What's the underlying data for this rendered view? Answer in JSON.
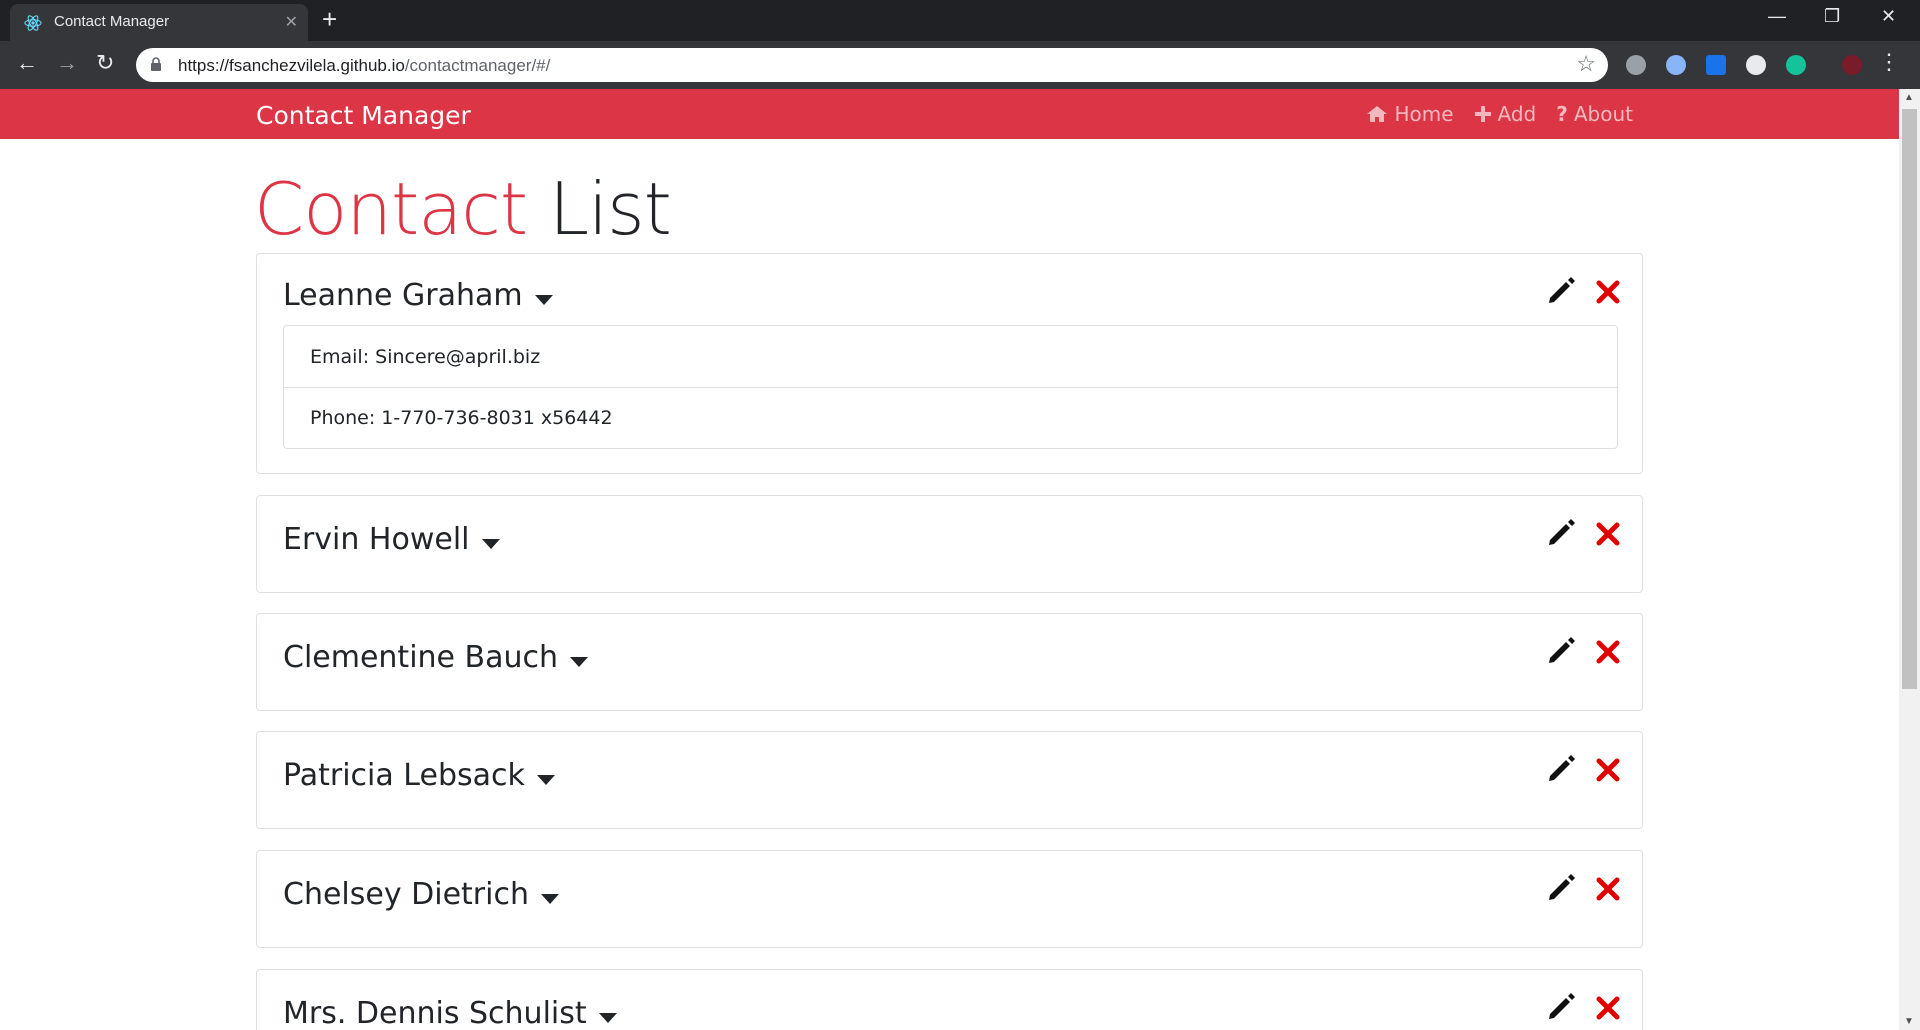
{
  "browser": {
    "tab_title": "Contact Manager",
    "url_host": "https://fsanchezvilela.github.io",
    "url_path": "/contactmanager/#/"
  },
  "navbar": {
    "brand": "Contact Manager",
    "links": [
      {
        "label": "Home",
        "icon": "home-icon"
      },
      {
        "label": "Add",
        "icon": "plus-icon"
      },
      {
        "label": "About",
        "icon": "question-icon"
      }
    ]
  },
  "heading": {
    "highlight": "Contact",
    "rest": "List"
  },
  "contacts": [
    {
      "name": "Leanne Graham",
      "email_label": "Email: Sincere@april.biz",
      "phone_label": "Phone: 1-770-736-8031 x56442",
      "expanded": true
    },
    {
      "name": "Ervin Howell"
    },
    {
      "name": "Clementine Bauch"
    },
    {
      "name": "Patricia Lebsack"
    },
    {
      "name": "Chelsey Dietrich"
    },
    {
      "name": "Mrs. Dennis Schulist"
    }
  ],
  "colors": {
    "brand": "#dc3545",
    "delete": "#e00000"
  }
}
